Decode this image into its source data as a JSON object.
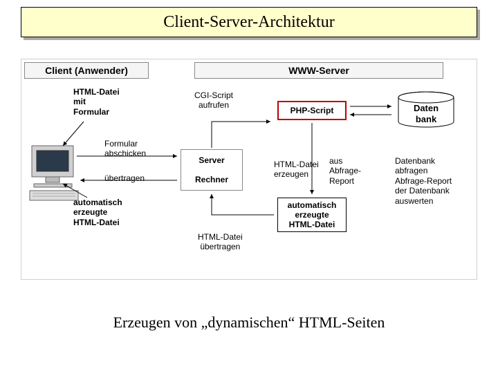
{
  "title": "Client-Server-Architektur",
  "headers": {
    "client": "Client (Anwender)",
    "www": "WWW-Server"
  },
  "labels": {
    "html_form": "HTML-Datei\nmit\nFormular",
    "form_send": "Formular\nabschicken",
    "transmit": "übertragen",
    "auto_html_left": "automatisch\nerzeugte\nHTML-Datei",
    "cgi_call": "CGI-Script\naufrufen",
    "server_rechner": "Server\n\nRechner",
    "html_transmit": "HTML-Datei\nübertragen",
    "php_script": "PHP-Script",
    "html_erzeugen": "HTML-Datei\nerzeugen",
    "aus_abfrage": "aus\nAbfrage-\nReport",
    "auto_html_right": "automatisch\nerzeugte\nHTML-Datei",
    "daten": "Daten",
    "bank": "bank",
    "db_right": "Datenbank\nabfragen\nAbfrage-Report\nder Datenbank\nauswerten"
  },
  "caption": "Erzeugen von „dynamischen“ HTML-Seiten"
}
